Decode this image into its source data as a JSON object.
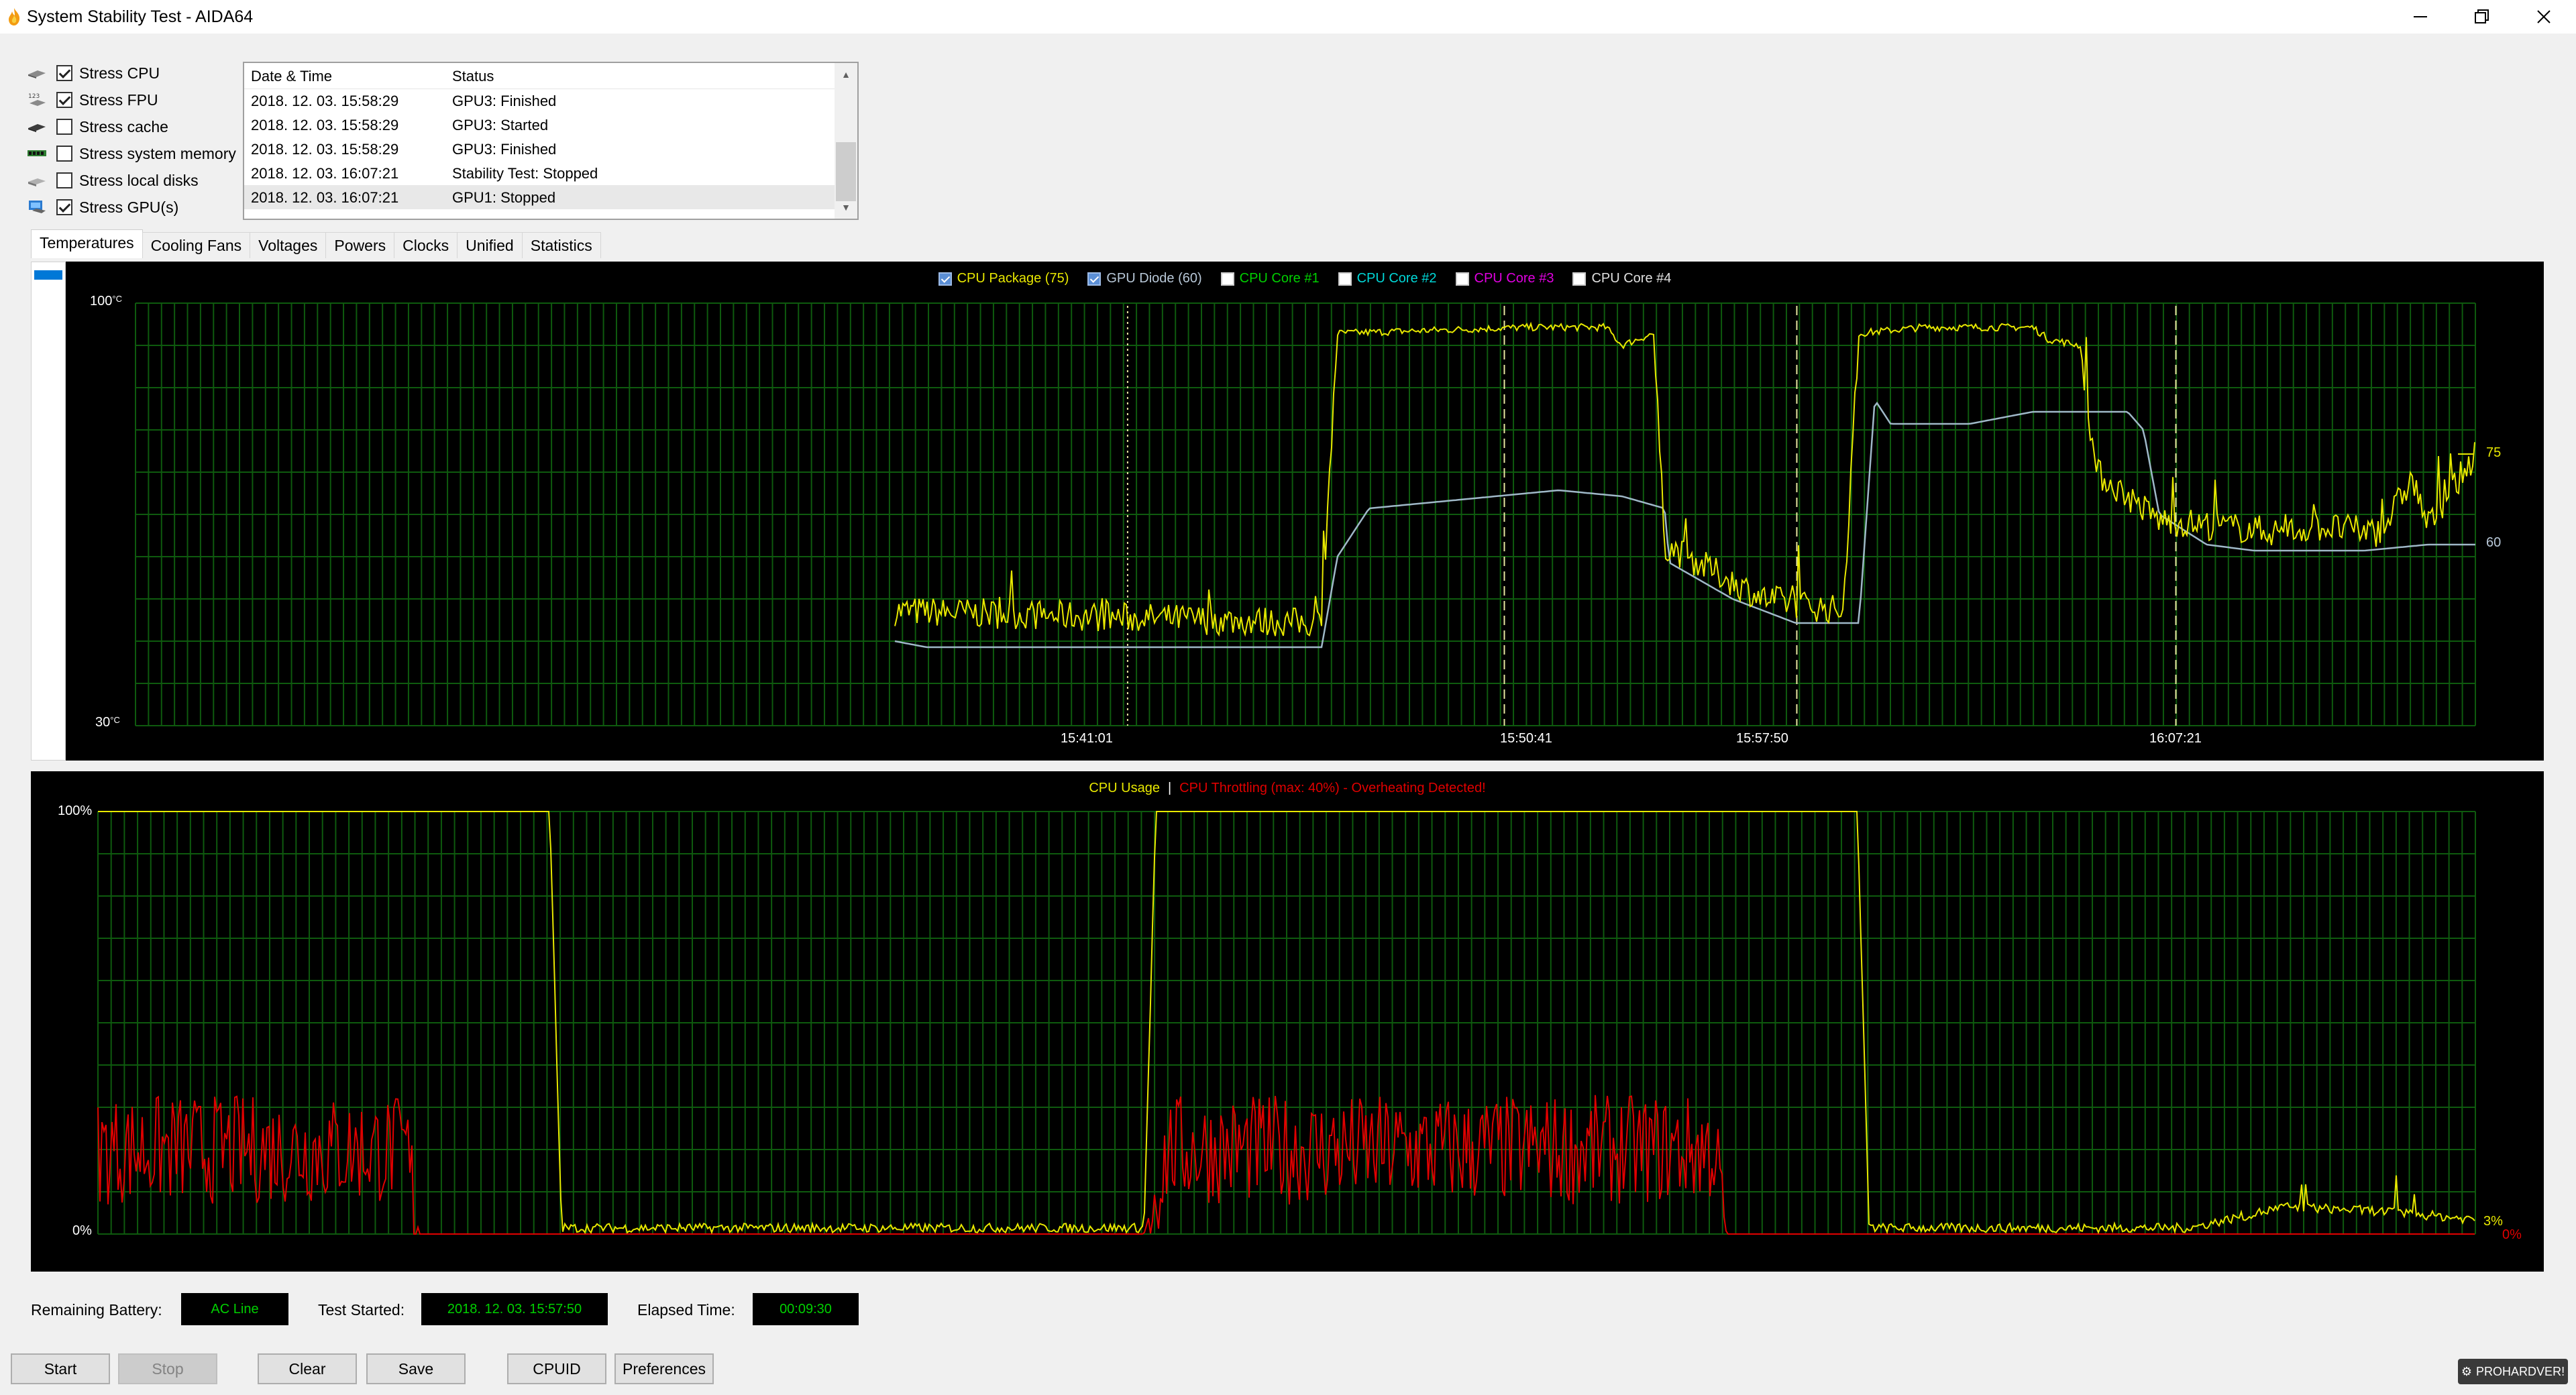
{
  "window": {
    "title": "System Stability Test - AIDA64"
  },
  "stress_options": [
    {
      "label": "Stress CPU",
      "checked": true,
      "icon": "cpu-icon"
    },
    {
      "label": "Stress FPU",
      "checked": true,
      "icon": "fpu-icon"
    },
    {
      "label": "Stress cache",
      "checked": false,
      "icon": "cache-icon"
    },
    {
      "label": "Stress system memory",
      "checked": false,
      "icon": "memory-icon"
    },
    {
      "label": "Stress local disks",
      "checked": false,
      "icon": "disk-icon"
    },
    {
      "label": "Stress GPU(s)",
      "checked": true,
      "icon": "gpu-icon"
    }
  ],
  "log": {
    "columns": [
      "Date & Time",
      "Status"
    ],
    "rows": [
      {
        "datetime": "2018. 12. 03. 15:58:29",
        "status": "GPU3: Finished"
      },
      {
        "datetime": "2018. 12. 03. 15:58:29",
        "status": "GPU3: Started"
      },
      {
        "datetime": "2018. 12. 03. 15:58:29",
        "status": "GPU3: Finished"
      },
      {
        "datetime": "2018. 12. 03. 16:07:21",
        "status": "Stability Test: Stopped"
      },
      {
        "datetime": "2018. 12. 03. 16:07:21",
        "status": "GPU1: Stopped"
      }
    ]
  },
  "tabs": [
    "Temperatures",
    "Cooling Fans",
    "Voltages",
    "Powers",
    "Clocks",
    "Unified",
    "Statistics"
  ],
  "active_tab": "Temperatures",
  "colors": {
    "yellow": "#e8e800",
    "gpu": "#9fb8c8",
    "green": "#00d000",
    "cyan": "#00d8d8",
    "magenta": "#e000e0",
    "white": "#ffffff",
    "red": "#e00000",
    "grid": "#0e5a0e",
    "marker": "#e8e8a0"
  },
  "temp_chart": {
    "legend": [
      {
        "label": "CPU Package (75)",
        "checked": true,
        "color": "#e8e800"
      },
      {
        "label": "GPU Diode (60)",
        "checked": true,
        "color": "#b8c8d8"
      },
      {
        "label": "CPU Core #1",
        "checked": false,
        "color": "#00d000"
      },
      {
        "label": "CPU Core #2",
        "checked": false,
        "color": "#00d8d8"
      },
      {
        "label": "CPU Core #3",
        "checked": false,
        "color": "#e000e0"
      },
      {
        "label": "CPU Core #4",
        "checked": false,
        "color": "#e0e0e0"
      }
    ],
    "y_max_label": "100",
    "y_min_label": "30",
    "unit": "°C",
    "time_labels": [
      "15:41:01",
      "15:50:41",
      "15:57:50",
      "16:07:21"
    ],
    "end_values": {
      "cpu": "75",
      "gpu": "60"
    }
  },
  "usage_chart": {
    "title_usage": "CPU Usage",
    "separator": "|",
    "title_throttle": "CPU Throttling (max: 40%) - Overheating Detected!",
    "y_max_label": "100%",
    "y_min_label": "0%",
    "end_values": {
      "usage": "3%",
      "throttle": "0%"
    }
  },
  "chart_data": [
    {
      "type": "line",
      "title": "",
      "ylabel": "°C",
      "ylim": [
        30,
        100
      ],
      "x_labels": [
        "15:41:01",
        "15:50:41",
        "15:57:50",
        "16:07:21"
      ],
      "series": [
        {
          "name": "CPU Package (75)",
          "approx_points": [
            [
              0.0,
              49
            ],
            [
              0.27,
              47
            ],
            [
              0.28,
              95
            ],
            [
              0.4,
              96
            ],
            [
              0.45,
              96
            ],
            [
              0.46,
              93
            ],
            [
              0.48,
              95
            ],
            [
              0.487,
              60
            ],
            [
              0.55,
              51
            ],
            [
              0.6,
              49
            ],
            [
              0.61,
              95
            ],
            [
              0.65,
              96
            ],
            [
              0.72,
              96
            ],
            [
              0.73,
              94
            ],
            [
              0.75,
              93
            ],
            [
              0.76,
              72
            ],
            [
              0.8,
              64
            ],
            [
              0.88,
              62
            ],
            [
              0.9,
              63
            ],
            [
              0.94,
              62
            ],
            [
              0.96,
              71
            ],
            [
              0.97,
              63
            ],
            [
              1.0,
              75
            ]
          ]
        },
        {
          "name": "GPU Diode (60)",
          "approx_points": [
            [
              0.0,
              44
            ],
            [
              0.02,
              43
            ],
            [
              0.27,
              43
            ],
            [
              0.28,
              58
            ],
            [
              0.3,
              66
            ],
            [
              0.38,
              68
            ],
            [
              0.42,
              69
            ],
            [
              0.46,
              68
            ],
            [
              0.487,
              66
            ],
            [
              0.49,
              57
            ],
            [
              0.53,
              51
            ],
            [
              0.57,
              47
            ],
            [
              0.61,
              47
            ],
            [
              0.62,
              84
            ],
            [
              0.63,
              80
            ],
            [
              0.68,
              80
            ],
            [
              0.72,
              82
            ],
            [
              0.78,
              82
            ],
            [
              0.79,
              79
            ],
            [
              0.8,
              65
            ],
            [
              0.83,
              60
            ],
            [
              0.86,
              59
            ],
            [
              0.93,
              59
            ],
            [
              0.97,
              60
            ],
            [
              1.0,
              60
            ]
          ]
        }
      ]
    },
    {
      "type": "line",
      "title": "",
      "ylim": [
        0,
        100
      ],
      "series": [
        {
          "name": "CPU Usage",
          "approx_points": [
            [
              0.0,
              100
            ],
            [
              0.19,
              100
            ],
            [
              0.195,
              1
            ],
            [
              0.44,
              1
            ],
            [
              0.445,
              100
            ],
            [
              0.74,
              100
            ],
            [
              0.745,
              1
            ],
            [
              0.88,
              1
            ],
            [
              0.92,
              6
            ],
            [
              0.96,
              5
            ],
            [
              1.0,
              3
            ]
          ]
        },
        {
          "name": "CPU Throttling (max: 40%) - Overheating Detected!",
          "approx_points": [
            [
              0.0,
              20
            ],
            [
              0.13,
              20
            ],
            [
              0.135,
              0
            ],
            [
              0.44,
              0
            ],
            [
              0.45,
              20
            ],
            [
              0.68,
              20
            ],
            [
              0.685,
              0
            ],
            [
              1.0,
              0
            ]
          ]
        }
      ]
    }
  ],
  "status": {
    "battery_label": "Remaining Battery:",
    "battery_value": "AC Line",
    "started_label": "Test Started:",
    "started_value": "2018. 12. 03. 15:57:50",
    "elapsed_label": "Elapsed Time:",
    "elapsed_value": "00:09:30"
  },
  "buttons": {
    "start": "Start",
    "stop": "Stop",
    "clear": "Clear",
    "save": "Save",
    "cpuid": "CPUID",
    "preferences": "Preferences"
  },
  "watermark": "PROHARDVER!"
}
